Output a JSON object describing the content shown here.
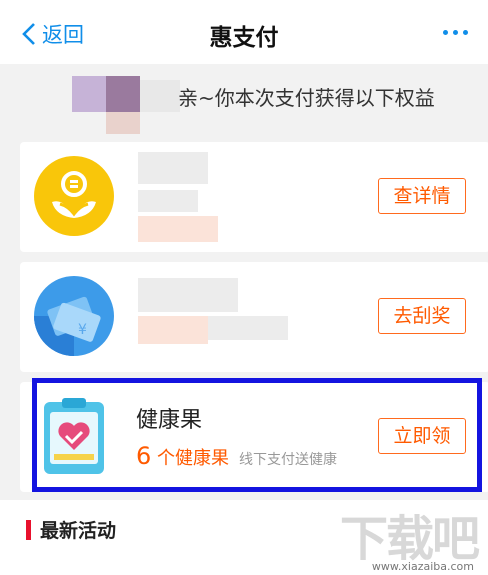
{
  "nav": {
    "back_label": "返回",
    "title": "惠支付"
  },
  "subtitle": "亲~你本次支付获得以下权益",
  "cards": [
    {
      "button_label": "查详情"
    },
    {
      "button_label": "去刮奖"
    },
    {
      "title": "健康果",
      "count": "6",
      "count_unit": "个健康果",
      "desc": "线下支付送健康",
      "button_label": "立即领"
    }
  ],
  "section": {
    "title": "最新活动"
  },
  "watermark": {
    "text": "下载吧",
    "url": "www.xiazaiba.com"
  },
  "colors": {
    "accent": "#108ee9",
    "orange": "#ff5a00",
    "highlight": "#1414e0",
    "red": "#e8112d"
  }
}
